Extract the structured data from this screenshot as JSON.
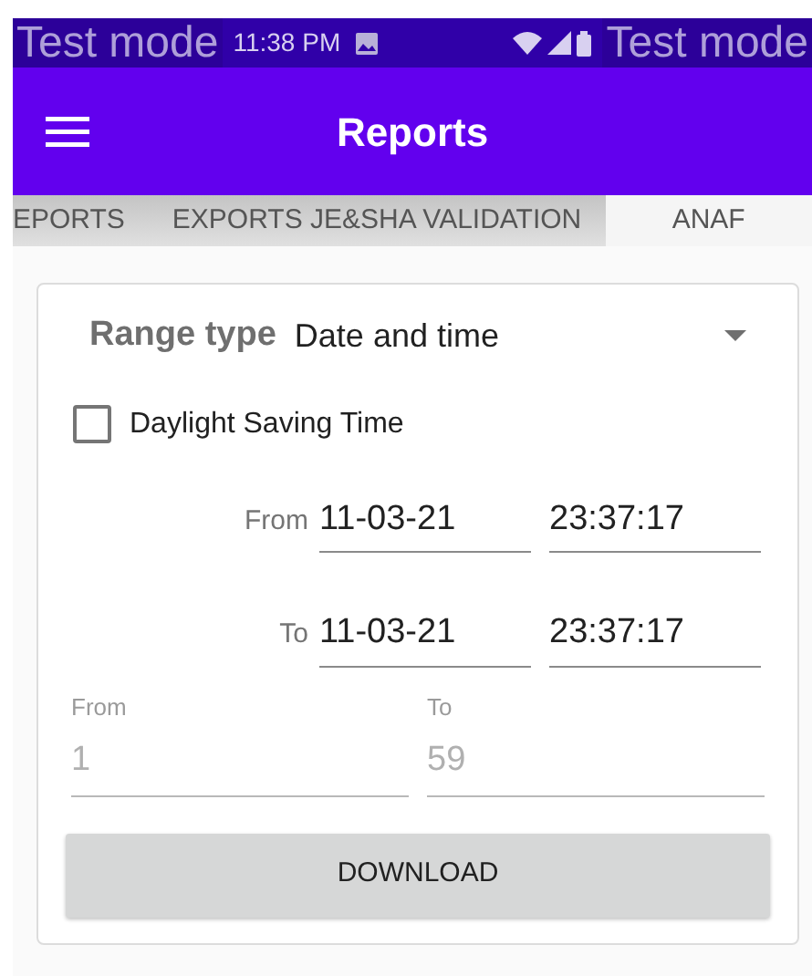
{
  "status_bar": {
    "time": "11:38 PM",
    "test_mode_labels": [
      "Test mode",
      "Test mode"
    ]
  },
  "app_bar": {
    "title": "Reports"
  },
  "tabs": [
    {
      "label": "EPORTS",
      "selected": false
    },
    {
      "label": "EXPORTS JE&SHA VALIDATION",
      "selected": false
    },
    {
      "label": "ANAF",
      "selected": true
    }
  ],
  "form": {
    "range_type": {
      "label": "Range type",
      "value": "Date and time"
    },
    "daylight_saving": {
      "label": "Daylight Saving Time",
      "checked": false
    },
    "from": {
      "label": "From",
      "date": "11-03-21",
      "time": "23:37:17"
    },
    "to": {
      "label": "To",
      "date": "11-03-21",
      "time": "23:37:17"
    },
    "number_range": [
      {
        "label": "From",
        "value": "1",
        "disabled": true
      },
      {
        "label": "To",
        "value": "59",
        "disabled": true
      }
    ],
    "download_button": "DOWNLOAD"
  }
}
